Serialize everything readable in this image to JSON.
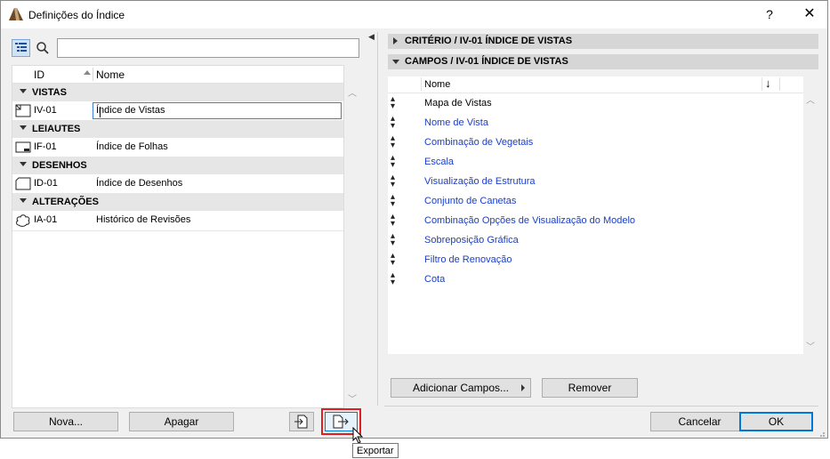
{
  "window": {
    "title": "Definições do Índice",
    "help": "?",
    "close": "✕"
  },
  "left": {
    "search_placeholder": "",
    "header": {
      "id": "ID",
      "name": "Nome"
    },
    "groups": [
      {
        "label": "VISTAS",
        "rows": [
          {
            "id": "IV-01",
            "name": "Índice de Vistas",
            "icon": "view-sheet-icon"
          }
        ]
      },
      {
        "label": "LEIAUTES",
        "rows": [
          {
            "id": "IF-01",
            "name": "Índice de Folhas",
            "icon": "layout-icon"
          }
        ]
      },
      {
        "label": "DESENHOS",
        "rows": [
          {
            "id": "ID-01",
            "name": "Índice de Desenhos",
            "icon": "drawing-icon"
          }
        ]
      },
      {
        "label": "ALTERAÇÕES",
        "rows": [
          {
            "id": "IA-01",
            "name": "Histórico de Revisões",
            "icon": "revision-cloud-icon"
          }
        ]
      }
    ],
    "buttons": {
      "new": "Nova...",
      "delete": "Apagar"
    }
  },
  "right": {
    "criteria_section": "CRITÉRIO / IV-01 ÍNDICE DE VISTAS",
    "fields_section": "CAMPOS / IV-01 ÍNDICE DE VISTAS",
    "header": {
      "name": "Nome",
      "sort_arrow": "↓"
    },
    "fields": [
      {
        "name": "Mapa de Vistas",
        "color": "#000000"
      },
      {
        "name": "Nome de Vista",
        "color": "#1a3ec8"
      },
      {
        "name": "Combinação de Vegetais",
        "color": "#1a3ec8"
      },
      {
        "name": "Escala",
        "color": "#1a3ec8"
      },
      {
        "name": "Visualização de Estrutura",
        "color": "#1a3ec8"
      },
      {
        "name": "Conjunto de Canetas",
        "color": "#1a3ec8"
      },
      {
        "name": "Combinação Opções de Visualização do Modelo",
        "color": "#1a3ec8"
      },
      {
        "name": "Sobreposição Gráfica",
        "color": "#1a3ec8"
      },
      {
        "name": "Filtro de Renovação",
        "color": "#1a3ec8"
      },
      {
        "name": "Cota",
        "color": "#1a3ec8"
      }
    ],
    "buttons": {
      "add_fields": "Adicionar Campos...",
      "remove": "Remover"
    }
  },
  "footer": {
    "cancel": "Cancelar",
    "ok": "OK"
  },
  "tooltip": "Exportar"
}
